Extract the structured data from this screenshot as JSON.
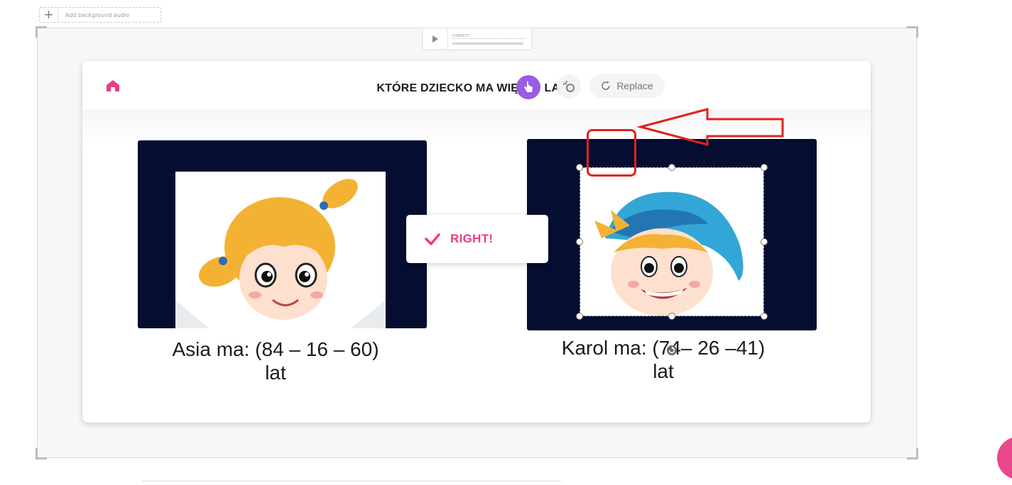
{
  "editor": {
    "add_audio_label": "Add background audio",
    "audio_track_label": "CORRECT"
  },
  "slide": {
    "title": "KTÓRE DZIECKO  MA WIĘCEJ LAT ?",
    "left_caption_line1": "Asia ma: (84 – 16 – 60)",
    "left_caption_line2": "lat",
    "right_caption_line1": "Karol  ma: (74– 26 –41)",
    "right_caption_line2": "lat",
    "feedback_text": "RIGHT!"
  },
  "image_toolbar": {
    "replace_label": "Replace"
  },
  "icons": {
    "home": "home-icon",
    "check": "check-icon",
    "touch": "hand-pointer-icon",
    "wand": "magic-wand-icon",
    "replace": "refresh-icon",
    "rotate": "rotate-icon"
  },
  "colors": {
    "accent_pink": "#ea3d86",
    "panel_navy": "#050d31",
    "touch_purple": "#9a5ce0",
    "annotation_red": "#e0221c"
  }
}
